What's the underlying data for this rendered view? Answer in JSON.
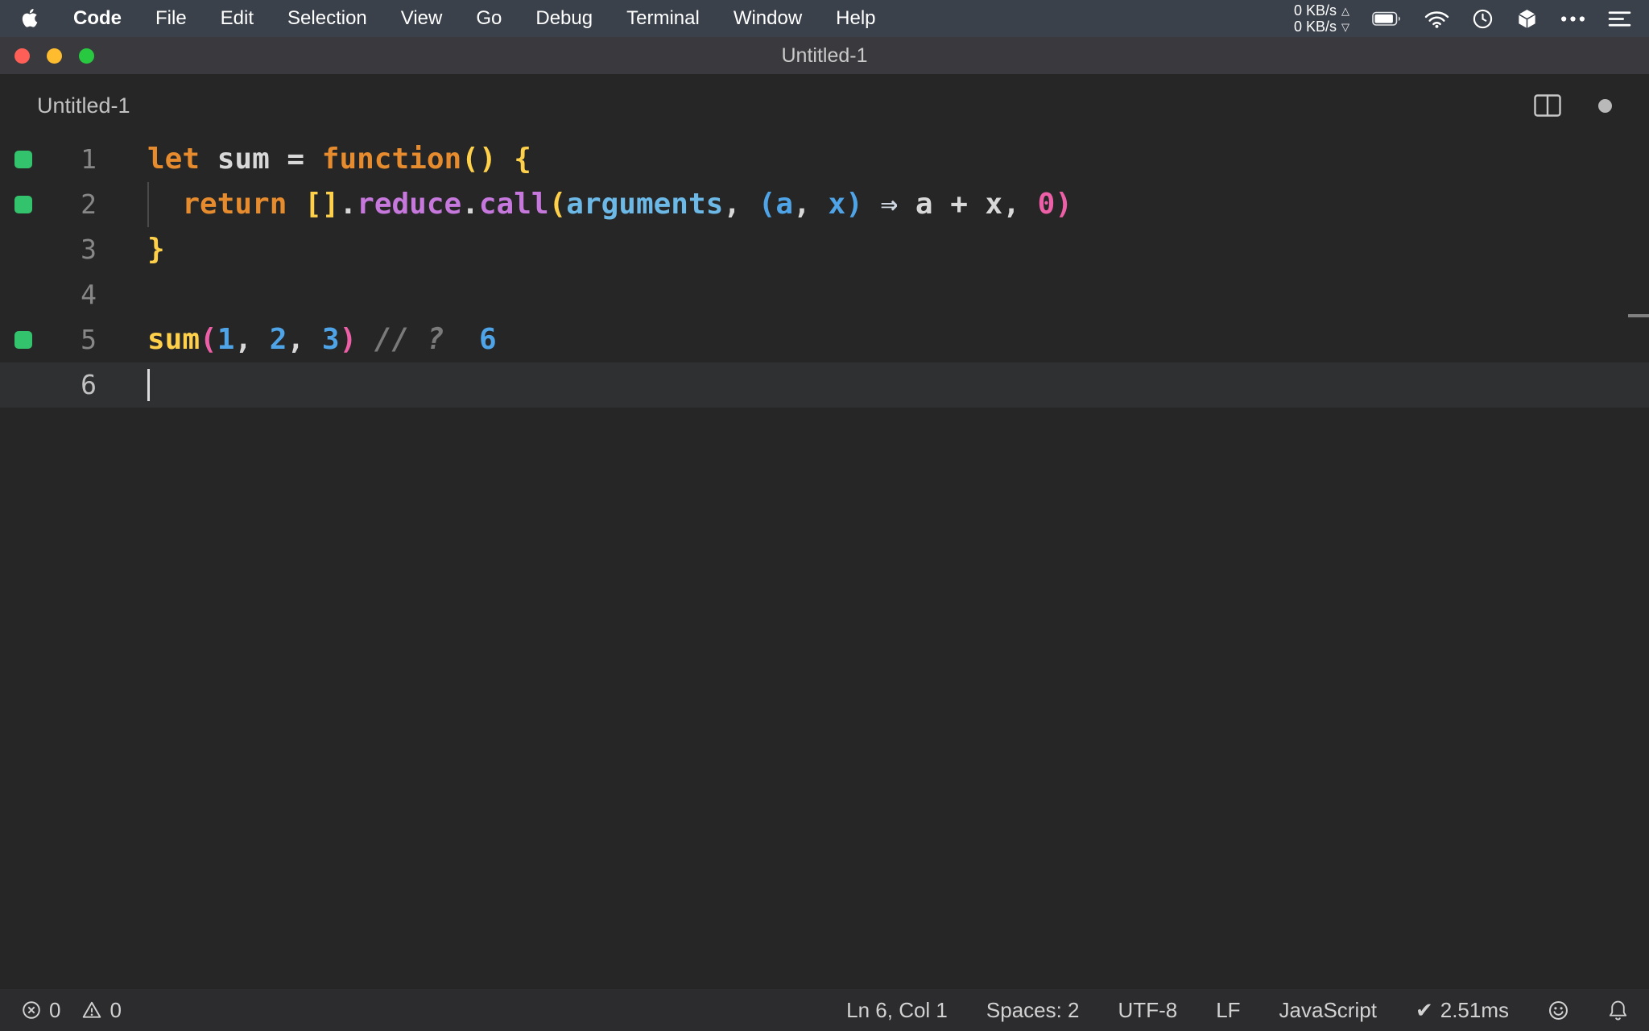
{
  "colors": {
    "menubar-bg": "#3a414b",
    "titlebar-bg": "#3a3a3e",
    "editor-bg": "#262626",
    "current-line-bg": "#2f3032",
    "statusbar-bg": "#2c2c2e",
    "gutter-green": "#34c36d",
    "line-number": "#878787",
    "tab-text": "#c2c2c2",
    "traffic-red": "#ff5f57",
    "traffic-yellow": "#febc2e",
    "traffic-green": "#28c840",
    "c-kw": "#e78c2e",
    "c-fg": "#d8d8d8",
    "c-y": "#ffd04a",
    "c-purple": "#c678dd",
    "c-lblue": "#6cb8e6",
    "c-blue": "#4fa4e8",
    "c-pink": "#ed5fa6",
    "c-comment": "#7a7a7a",
    "c-arrow": "#cfd8e3",
    "c-val": "#4fa4e8"
  },
  "icons": {
    "upload_arrow": "△",
    "download_arrow": "▽",
    "perf_check": "✔"
  },
  "menu_bar": {
    "items": [
      "Code",
      "File",
      "Edit",
      "Selection",
      "View",
      "Go",
      "Debug",
      "Terminal",
      "Window",
      "Help"
    ],
    "net_up": "0 KB/s",
    "net_down": "0 KB/s"
  },
  "window": {
    "title": "Untitled-1"
  },
  "editor": {
    "tab_label": "Untitled-1",
    "lines": [
      {
        "num": "1",
        "marker": true,
        "tokens": [
          {
            "t": "let",
            "c": "kw"
          },
          {
            "t": " ",
            "c": "fg"
          },
          {
            "t": "sum",
            "c": "fg"
          },
          {
            "t": " = ",
            "c": "fg"
          },
          {
            "t": "function",
            "c": "kw"
          },
          {
            "t": "()",
            "c": "y"
          },
          {
            "t": " ",
            "c": "fg"
          },
          {
            "t": "{",
            "c": "y"
          }
        ]
      },
      {
        "num": "2",
        "marker": true,
        "indent_guide": true,
        "tokens": [
          {
            "t": "  ",
            "c": "fg"
          },
          {
            "t": "return",
            "c": "kw"
          },
          {
            "t": " ",
            "c": "fg"
          },
          {
            "t": "[]",
            "c": "y"
          },
          {
            "t": ".",
            "c": "fg"
          },
          {
            "t": "reduce",
            "c": "purple"
          },
          {
            "t": ".",
            "c": "fg"
          },
          {
            "t": "call",
            "c": "purple"
          },
          {
            "t": "(",
            "c": "y"
          },
          {
            "t": "arguments",
            "c": "lblue"
          },
          {
            "t": ", ",
            "c": "fg"
          },
          {
            "t": "(",
            "c": "blue"
          },
          {
            "t": "a",
            "c": "blue"
          },
          {
            "t": ", ",
            "c": "fg"
          },
          {
            "t": "x",
            "c": "blue"
          },
          {
            "t": ")",
            "c": "blue"
          },
          {
            "t": " ",
            "c": "fg"
          },
          {
            "t": "⇒",
            "c": "arrow"
          },
          {
            "t": " a + x",
            "c": "fg"
          },
          {
            "t": ", ",
            "c": "fg"
          },
          {
            "t": "0",
            "c": "pink"
          },
          {
            "t": ")",
            "c": "pink"
          }
        ]
      },
      {
        "num": "3",
        "marker": false,
        "tokens": [
          {
            "t": "}",
            "c": "y"
          }
        ]
      },
      {
        "num": "4",
        "marker": false,
        "tokens": []
      },
      {
        "num": "5",
        "marker": true,
        "tokens": [
          {
            "t": "sum",
            "c": "y"
          },
          {
            "t": "(",
            "c": "pink"
          },
          {
            "t": "1",
            "c": "blue"
          },
          {
            "t": ", ",
            "c": "fg"
          },
          {
            "t": "2",
            "c": "blue"
          },
          {
            "t": ", ",
            "c": "fg"
          },
          {
            "t": "3",
            "c": "blue"
          },
          {
            "t": ")",
            "c": "pink"
          },
          {
            "t": " ",
            "c": "fg"
          },
          {
            "t": "// ?",
            "c": "comment"
          },
          {
            "t": "  ",
            "c": "fg"
          },
          {
            "t": "6",
            "c": "val"
          }
        ]
      },
      {
        "num": "6",
        "marker": false,
        "current": true,
        "cursor": true,
        "tokens": []
      }
    ]
  },
  "status_bar": {
    "errors": "0",
    "warnings": "0",
    "cursor_position": "Ln 6, Col 1",
    "indentation": "Spaces: 2",
    "encoding": "UTF-8",
    "eol": "LF",
    "language": "JavaScript",
    "perf_time": "2.51ms"
  }
}
